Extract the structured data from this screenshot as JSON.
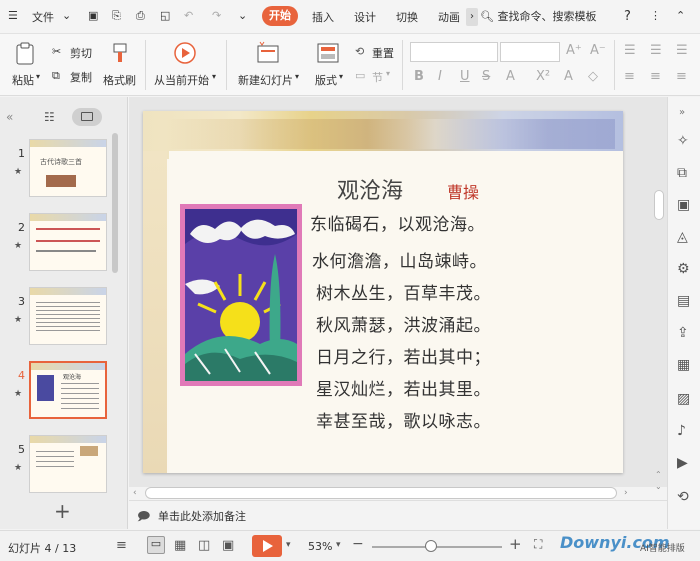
{
  "titlebar": {
    "menu_label": "文件",
    "tabs": [
      {
        "label": "开始",
        "active": true
      },
      {
        "label": "插入"
      },
      {
        "label": "设计"
      },
      {
        "label": "切换"
      },
      {
        "label": "动画"
      }
    ],
    "search_text": "查找命令、搜索模板",
    "help": "?"
  },
  "ribbon": {
    "paste": "粘贴",
    "cut": "剪切",
    "copy": "复制",
    "format_painter": "格式刷",
    "from_current": "从当前开始",
    "new_slide": "新建幻灯片",
    "layout": "版式",
    "reset": "重置",
    "section": "节"
  },
  "slides_panel": {
    "thumbs": [
      {
        "num": "1",
        "text": "古代诗歌三首"
      },
      {
        "num": "2",
        "text": ""
      },
      {
        "num": "3",
        "text": ""
      },
      {
        "num": "4",
        "text": "观沧海",
        "selected": true
      },
      {
        "num": "5",
        "text": ""
      }
    ],
    "add": "+"
  },
  "slide": {
    "title": "观沧海",
    "author": "曹操",
    "lines": [
      "东临碣石，以观沧海。",
      "水何澹澹，山岛竦峙。",
      "树木丛生，百草丰茂。",
      "秋风萧瑟，洪波涌起。",
      "日月之行，若出其中；",
      "星汉灿烂，若出其里。",
      "幸甚至哉，歌以咏志。"
    ]
  },
  "notes": {
    "placeholder": "单击此处添加备注"
  },
  "status": {
    "slide_counter": "幻灯片 4 / 13",
    "zoom": "53%",
    "zoom_level": 0.45,
    "watermark": "Downyi.com",
    "ai_label": "AI智能排版"
  },
  "colors": {
    "accent": "#e8633c",
    "title_red": "#c0392b"
  }
}
